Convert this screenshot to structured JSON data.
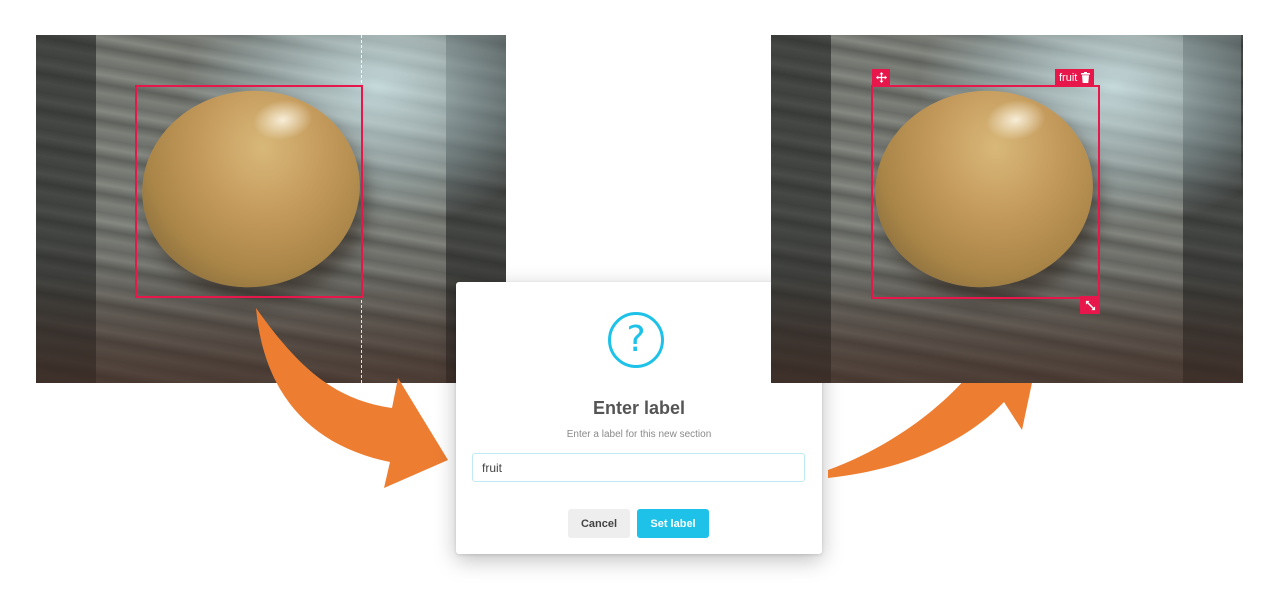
{
  "left_panel": {
    "has_guide_line": true
  },
  "right_panel": {
    "box_label": "fruit"
  },
  "dialog": {
    "icon": "question-icon",
    "icon_glyph": "?",
    "title": "Enter label",
    "subtitle": "Enter a label for this new section",
    "input_value": "fruit",
    "cancel_label": "Cancel",
    "confirm_label": "Set label"
  },
  "colors": {
    "box": "#e8174b",
    "accent": "#1ec2e8",
    "arrow": "#ed7d31"
  }
}
